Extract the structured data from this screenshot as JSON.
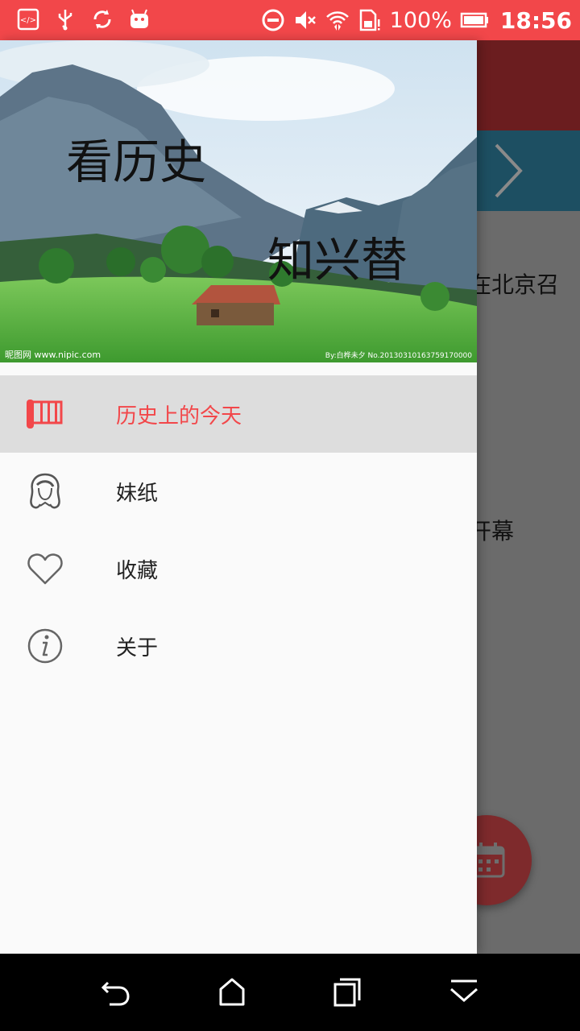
{
  "status_bar": {
    "icons_left": [
      "code-icon",
      "usb-icon",
      "sync-icon",
      "android-icon"
    ],
    "icons_right": [
      "dnd-icon",
      "volume-mute-icon",
      "wifi-icon",
      "sim-icon",
      "battery-icon"
    ],
    "battery": "100%",
    "time": "18:56",
    "color": "#f2474a"
  },
  "background": {
    "line1": "在北京召",
    "line2": "开幕",
    "toolbar_color": "#6b1d1f",
    "tabbar_color": "#1d4f62"
  },
  "drawer": {
    "header": {
      "line1": "看历史",
      "line2": "知兴替",
      "watermark_left": "昵图网 www.nipic.com",
      "watermark_right": "By:白桦未夕 No.20130310163759170000"
    },
    "menu": [
      {
        "label": "历史上的今天",
        "icon": "history-scroll-icon",
        "selected": true
      },
      {
        "label": "妹纸",
        "icon": "girl-icon",
        "selected": false
      },
      {
        "label": "收藏",
        "icon": "heart-icon",
        "selected": false
      },
      {
        "label": "关于",
        "icon": "info-icon",
        "selected": false
      }
    ],
    "accent_color": "#f2474a"
  },
  "nav_bar": {
    "buttons": [
      "back-icon",
      "home-icon",
      "recents-icon",
      "hide-nav-icon"
    ]
  }
}
